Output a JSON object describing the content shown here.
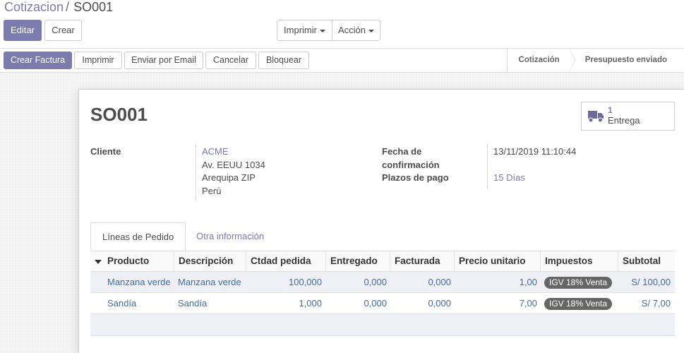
{
  "breadcrumb": {
    "parent": "Cotizacion",
    "separator": "/",
    "current": "SO001"
  },
  "buttons": {
    "edit": "Editar",
    "create": "Crear",
    "print": "Imprimir",
    "action": "Acción"
  },
  "statusbar": {
    "actions": [
      "Crear Factura",
      "Imprimir",
      "Enviar por Email",
      "Cancelar",
      "Bloquear"
    ],
    "stages": [
      "Cotización",
      "Presupuesto enviado"
    ]
  },
  "record": {
    "title": "SO001",
    "smart_button": {
      "value": "1",
      "label": "Entrega",
      "icon": "truck-icon"
    },
    "customer_label": "Cliente",
    "customer": {
      "name": "ACME",
      "street": "Av. EEUU 1034",
      "city": "Arequipa ZIP",
      "country": "Perú"
    },
    "confirmation_label_1": "Fecha de",
    "confirmation_label_2": "confirmación",
    "confirmation_date": "13/11/2019 11:10:44",
    "payment_terms_label": "Plazos de pago",
    "payment_terms": "15 Días"
  },
  "tabs": [
    "Líneas de Pedido",
    "Otra información"
  ],
  "table": {
    "headers": [
      "Producto",
      "Descripción",
      "Ctdad pedida",
      "Entregado",
      "Facturada",
      "Precio unitario",
      "Impuestos",
      "Subtotal"
    ],
    "rows": [
      [
        "Manzana verde",
        "Manzana verde",
        "100,000",
        "0,000",
        "0,000",
        "1,00",
        "IGV 18% Venta",
        "S/ 100,00"
      ],
      [
        "Sandía",
        "Sandía",
        "1,000",
        "0,000",
        "0,000",
        "7,00",
        "IGV 18% Venta",
        "S/ 7,00"
      ]
    ]
  },
  "colors": {
    "primary": "#7c7bad",
    "link": "#3f6ea8",
    "badge": "#666666"
  }
}
